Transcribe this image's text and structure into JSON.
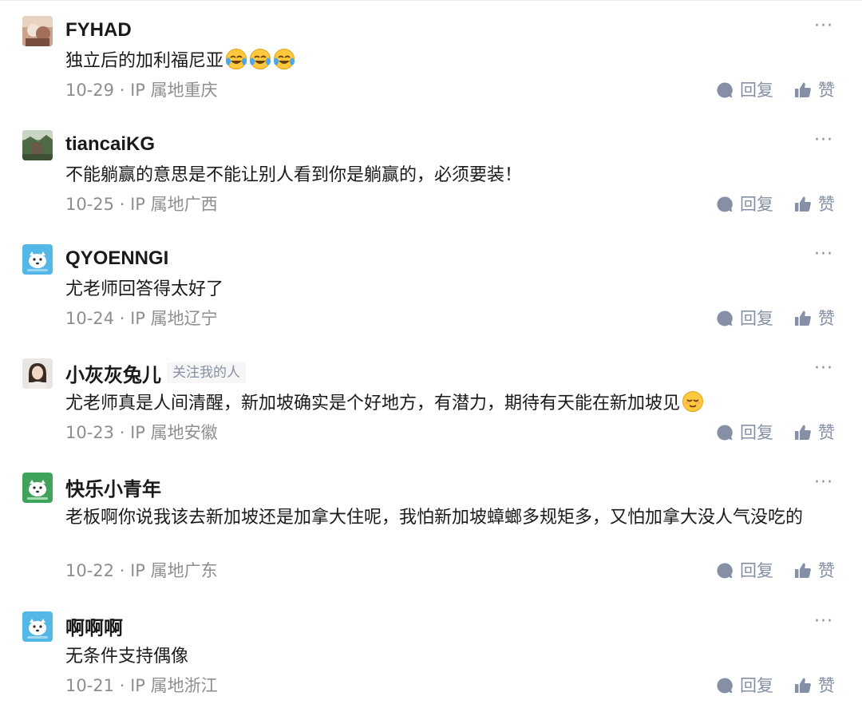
{
  "comments": [
    {
      "user": "FYHAD",
      "badge": "",
      "text": "独立后的加利福尼亚",
      "emoji": [
        "laugh-cry",
        "laugh-cry",
        "laugh-cry"
      ],
      "date": "10-29",
      "ip": "IP 属地重庆",
      "reply": "回复",
      "like": "赞",
      "more": "···",
      "avatar_icon": "photo-avatar-icon"
    },
    {
      "user": "tiancaiKG",
      "badge": "",
      "text": "不能躺赢的意思是不能让别人看到你是躺赢的，必须要装！",
      "emoji": [],
      "date": "10-25",
      "ip": "IP 属地广西",
      "reply": "回复",
      "like": "赞",
      "more": "···",
      "avatar_icon": "landscape-avatar-icon"
    },
    {
      "user": "QYOENNGI",
      "badge": "",
      "text": "尤老师回答得太好了",
      "emoji": [],
      "date": "10-24",
      "ip": "IP 属地辽宁",
      "reply": "回复",
      "like": "赞",
      "more": "···",
      "avatar_icon": "default-avatar-icon"
    },
    {
      "user": "小灰灰兔儿",
      "badge": "关注我的人",
      "text": "尤老师真是人间清醒，新加坡确实是个好地方，有潜力，期待有天能在新加坡见",
      "emoji": [
        "relieved"
      ],
      "date": "10-23",
      "ip": "IP 属地安徽",
      "reply": "回复",
      "like": "赞",
      "more": "···",
      "avatar_icon": "portrait-avatar-icon"
    },
    {
      "user": "快乐小青年",
      "badge": "",
      "text": "老板啊你说我该去新加坡还是加拿大住呢，我怕新加坡蟑螂多规矩多，又怕加拿大没人气没吃的",
      "emoji": [],
      "date": "10-22",
      "ip": "IP 属地广东",
      "reply": "回复",
      "like": "赞",
      "more": "···",
      "avatar_icon": "default-avatar-green-icon"
    },
    {
      "user": "啊啊啊",
      "badge": "",
      "text": "无条件支持偶像",
      "emoji": [],
      "date": "10-21",
      "ip": "IP 属地浙江",
      "reply": "回复",
      "like": "赞",
      "more": "···",
      "avatar_icon": "default-avatar-icon"
    }
  ],
  "colors": {
    "meta": "#8e8e8e",
    "action": "#8590a6",
    "text": "#1a1a1a",
    "default_avatar_bg": "#53b7e8",
    "green_avatar_bg": "#3fa35a"
  }
}
